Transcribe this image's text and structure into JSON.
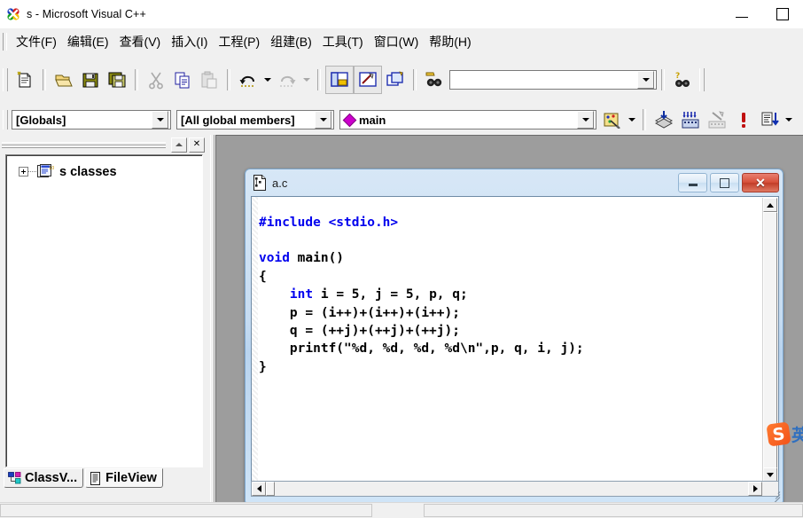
{
  "window": {
    "title": "s - Microsoft Visual C++",
    "icon": "vcpp-logo-icon",
    "buttons": {
      "minimize": "—",
      "maximize": "□"
    }
  },
  "menu": {
    "items": [
      {
        "label": "文件(F)",
        "name": "menu-file"
      },
      {
        "label": "编辑(E)",
        "name": "menu-edit"
      },
      {
        "label": "查看(V)",
        "name": "menu-view"
      },
      {
        "label": "插入(I)",
        "name": "menu-insert"
      },
      {
        "label": "工程(P)",
        "name": "menu-project"
      },
      {
        "label": "组建(B)",
        "name": "menu-build"
      },
      {
        "label": "工具(T)",
        "name": "menu-tools"
      },
      {
        "label": "窗口(W)",
        "name": "menu-window"
      },
      {
        "label": "帮助(H)",
        "name": "menu-help"
      }
    ]
  },
  "toolbar_standard": {
    "buttons": [
      "new-text-file-icon",
      "open-folder-icon",
      "save-icon",
      "save-all-icon",
      "cut-scissors-icon",
      "copy-icon",
      "paste-icon",
      "undo-icon",
      "undo-dropdown-icon",
      "redo-icon",
      "redo-dropdown-icon",
      "workspace-window-icon",
      "output-window-icon",
      "window-list-icon",
      "find-in-files-icon"
    ],
    "search": {
      "value": "",
      "placeholder": ""
    },
    "help_search": "find-help-icon"
  },
  "toolbar_wizardbar": {
    "class_combo": {
      "value": "[Globals]",
      "name": "class-combo"
    },
    "filter_combo": {
      "value": "[All global members]",
      "name": "members-combo"
    },
    "member_combo": {
      "value": "main",
      "icon": "magenta-diamond-icon",
      "name": "function-combo"
    },
    "actions": [
      "wizardbar-action-icon",
      "wizardbar-dropdown-icon",
      "compile-icon",
      "build-icon",
      "stop-build-icon",
      "execute-icon",
      "go-debug-icon"
    ]
  },
  "workspace": {
    "header_buttons": {
      "dock": "▲",
      "close": "✕"
    },
    "tree": [
      {
        "label": "s classes",
        "expander": "+",
        "icon": "classes-folder-icon"
      }
    ],
    "tabs": [
      {
        "label": "ClassV...",
        "name": "tab-classview",
        "icon": "classview-icon",
        "active": true
      },
      {
        "label": "FileView",
        "name": "tab-fileview",
        "icon": "fileview-icon",
        "active": false
      }
    ]
  },
  "editor_window": {
    "title": "a.c",
    "icon": "c-source-file-icon",
    "buttons": {
      "minimize": "minimize-icon",
      "maximize": "maximize-icon",
      "close": "✕"
    },
    "code_lines": [
      [
        {
          "t": "#include",
          "c": "kw"
        },
        {
          "t": " ",
          "c": ""
        },
        {
          "t": "<stdio.h>",
          "c": "kw"
        }
      ],
      [
        {
          "t": "",
          "c": ""
        }
      ],
      [
        {
          "t": "void",
          "c": "kw"
        },
        {
          "t": " main()",
          "c": ""
        }
      ],
      [
        {
          "t": "{",
          "c": ""
        }
      ],
      [
        {
          "t": "    ",
          "c": ""
        },
        {
          "t": "int",
          "c": "kw"
        },
        {
          "t": " i = 5, j = 5, p, q;",
          "c": ""
        }
      ],
      [
        {
          "t": "    p = (i++)+(i++)+(i++);",
          "c": ""
        }
      ],
      [
        {
          "t": "    q = (++j)+(++j)+(++j);",
          "c": ""
        }
      ],
      [
        {
          "t": "    printf(\"%d, %d, %d, %d\\n\",p, q, i, j);",
          "c": ""
        }
      ],
      [
        {
          "t": "}",
          "c": ""
        }
      ]
    ]
  },
  "ime": {
    "logo": "S",
    "mode": "英"
  },
  "colors": {
    "keyword_blue": "#0000ee",
    "accent_magenta": "#cc00cc",
    "window_chrome": "#f0f0f0",
    "mdi_background": "#9d9d9d",
    "child_title_blue": "#c6dcf2",
    "close_red": "#d7503a",
    "sogou_orange": "#f2521a"
  },
  "statusbar": {
    "text": ""
  }
}
